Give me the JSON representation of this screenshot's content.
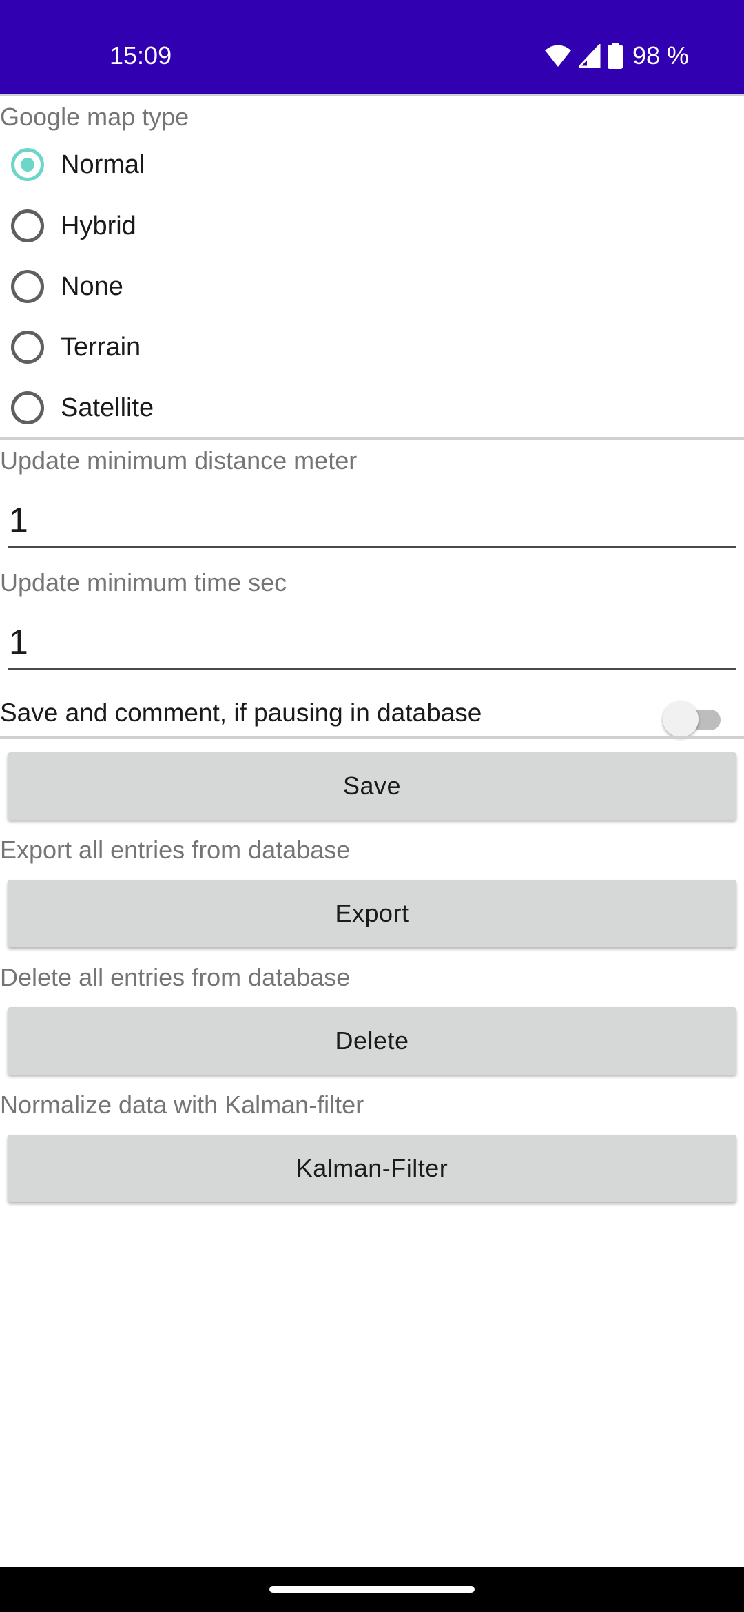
{
  "status_bar": {
    "time": "15:09",
    "battery": "98 %",
    "icons": [
      "wifi-icon",
      "signal-icon",
      "battery-icon"
    ],
    "background": "#3100b0"
  },
  "map_type": {
    "label": "Google map type",
    "options": [
      "Normal",
      "Hybrid",
      "None",
      "Terrain",
      "Satellite"
    ],
    "selected": "Normal",
    "accent": "#6ed6c6"
  },
  "min_distance": {
    "label": "Update minimum distance meter",
    "value": "1"
  },
  "min_time": {
    "label": "Update minimum time sec",
    "value": "1"
  },
  "pause_switch": {
    "label": "Save and comment, if pausing in database",
    "on": false
  },
  "save": {
    "button_label": "Save"
  },
  "export": {
    "label": "Export all entries from database",
    "button_label": "Export"
  },
  "delete": {
    "label": "Delete all entries from database",
    "button_label": "Delete"
  },
  "kalman": {
    "label": "Normalize data with Kalman-filter",
    "button_label": "Kalman-Filter"
  }
}
